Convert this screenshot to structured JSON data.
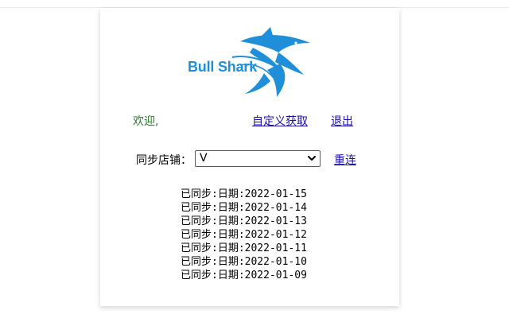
{
  "brand": {
    "name": "Bull Shark",
    "color": "#1e8fd8"
  },
  "header": {
    "welcome": "欢迎,",
    "custom_fetch_link": "自定义获取",
    "logout_link": "退出"
  },
  "store": {
    "label": "同步店铺：",
    "selected": "V",
    "reconnect_link": "重连"
  },
  "sync_log": [
    "已同步:日期:2022-01-15",
    "已同步:日期:2022-01-14",
    "已同步:日期:2022-01-13",
    "已同步:日期:2022-01-12",
    "已同步:日期:2022-01-11",
    "已同步:日期:2022-01-10",
    "已同步:日期:2022-01-09"
  ],
  "colors": {
    "link": "#1a0dab",
    "welcome": "#2a7a2a"
  },
  "icons": {
    "logo": "shark-logo-icon",
    "select": "chevron-down-icon"
  }
}
